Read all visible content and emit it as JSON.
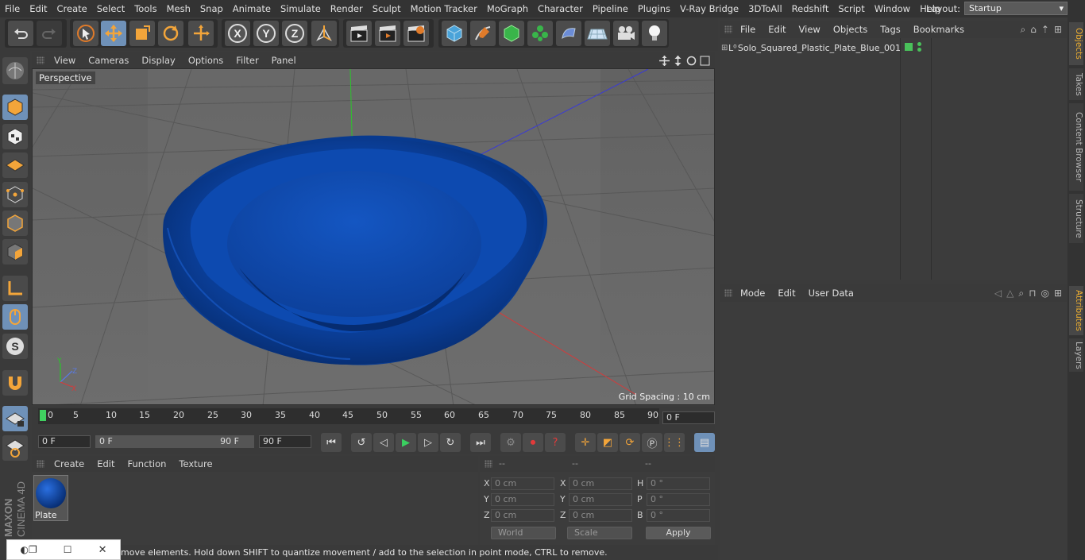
{
  "menubar": {
    "items": [
      "File",
      "Edit",
      "Create",
      "Select",
      "Tools",
      "Mesh",
      "Snap",
      "Animate",
      "Simulate",
      "Render",
      "Sculpt",
      "Motion Tracker",
      "MoGraph",
      "Character",
      "Pipeline",
      "Plugins",
      "V-Ray Bridge",
      "3DToAll",
      "Redshift",
      "Script",
      "Window",
      "Help"
    ],
    "layout_label": "Layout:",
    "layout_value": "Startup"
  },
  "viewport": {
    "menu": [
      "View",
      "Cameras",
      "Display",
      "Options",
      "Filter",
      "Panel"
    ],
    "label": "Perspective",
    "grid_spacing": "Grid Spacing : 10 cm"
  },
  "timeline": {
    "ticks": [
      "0",
      "5",
      "10",
      "15",
      "20",
      "25",
      "30",
      "35",
      "40",
      "45",
      "50",
      "55",
      "60",
      "65",
      "70",
      "75",
      "80",
      "85",
      "90"
    ],
    "current_frame": "0 F",
    "start_field": "0 F",
    "range_start": "0 F",
    "range_end": "90 F",
    "end_field": "90 F"
  },
  "material_manager": {
    "menu": [
      "Create",
      "Edit",
      "Function",
      "Texture"
    ],
    "material_name": "Plate"
  },
  "coordinates": {
    "headers": [
      "--",
      "--",
      "--"
    ],
    "rows": [
      {
        "l1": "X",
        "v1": "0 cm",
        "l2": "X",
        "v2": "0 cm",
        "l3": "H",
        "v3": "0 °"
      },
      {
        "l1": "Y",
        "v1": "0 cm",
        "l2": "Y",
        "v2": "0 cm",
        "l3": "P",
        "v3": "0 °"
      },
      {
        "l1": "Z",
        "v1": "0 cm",
        "l2": "Z",
        "v2": "0 cm",
        "l3": "B",
        "v3": "0 °"
      }
    ],
    "world": "World",
    "scale": "Scale",
    "apply": "Apply"
  },
  "status": {
    "text": "move elements. Hold down SHIFT to quantize movement / add to the selection in point mode, CTRL to remove."
  },
  "objects_panel": {
    "menu": [
      "File",
      "Edit",
      "View",
      "Objects",
      "Tags",
      "Bookmarks"
    ],
    "object_name": "Solo_Squared_Plastic_Plate_Blue_001"
  },
  "attributes_panel": {
    "menu": [
      "Mode",
      "Edit",
      "User Data"
    ]
  },
  "side_tabs": [
    "Objects",
    "Takes",
    "Content Browser",
    "Structure",
    "Attributes",
    "Layers"
  ],
  "branding": "MAXON CINEMA 4D",
  "colors": {
    "accent": "#6f91b8",
    "plate": "#0d47a8",
    "active_tab": "#f0b030"
  }
}
